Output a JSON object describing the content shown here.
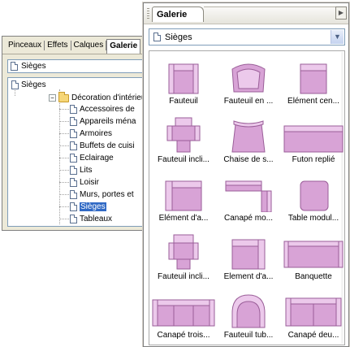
{
  "back_panel": {
    "tabs": [
      "Pinceaux",
      "Effets",
      "Calques",
      "Galerie"
    ],
    "active_tab": 3,
    "dropdown_value": "Sièges",
    "tree": [
      {
        "label": "Sièges",
        "type": "doc",
        "level": 0
      },
      {
        "label": "Décoration d'intérieur",
        "type": "folder",
        "level": 1,
        "expanded": true
      },
      {
        "label": "Accessoires de",
        "type": "doc",
        "level": 2
      },
      {
        "label": "Appareils ména",
        "type": "doc",
        "level": 2
      },
      {
        "label": "Armoires",
        "type": "doc",
        "level": 2
      },
      {
        "label": "Buffets de cuisi",
        "type": "doc",
        "level": 2
      },
      {
        "label": "Eclairage",
        "type": "doc",
        "level": 2
      },
      {
        "label": "Lits",
        "type": "doc",
        "level": 2
      },
      {
        "label": "Loisir",
        "type": "doc",
        "level": 2
      },
      {
        "label": "Murs, portes et",
        "type": "doc",
        "level": 2
      },
      {
        "label": "Sièges",
        "type": "doc",
        "level": 2,
        "selected": true
      },
      {
        "label": "Tableaux",
        "type": "doc",
        "level": 2
      }
    ]
  },
  "gallery": {
    "tab_label": "Galerie",
    "dropdown_value": "Sièges",
    "colors": {
      "fill": "#d8a3d6",
      "stroke": "#9a5e98",
      "light": "#ecc9eb"
    },
    "items": [
      {
        "label": "Fauteuil",
        "shape": "armchair"
      },
      {
        "label": "Fauteuil en ...",
        "shape": "armchair-round"
      },
      {
        "label": "Elément cen...",
        "shape": "center-piece"
      },
      {
        "label": "Fauteuil incli...",
        "shape": "recliner"
      },
      {
        "label": "Chaise de s...",
        "shape": "desk-chair"
      },
      {
        "label": "Futon replié",
        "shape": "futon"
      },
      {
        "label": "Elément d'a...",
        "shape": "corner"
      },
      {
        "label": "Canapé mo...",
        "shape": "l-sofa"
      },
      {
        "label": "Table modul...",
        "shape": "table"
      },
      {
        "label": "Fauteuil incli...",
        "shape": "recliner2"
      },
      {
        "label": "Element d'a...",
        "shape": "corner2"
      },
      {
        "label": "Banquette",
        "shape": "bench"
      },
      {
        "label": "Canapé trois...",
        "shape": "sofa3"
      },
      {
        "label": "Fauteuil tub...",
        "shape": "tub"
      },
      {
        "label": "Canapé deu...",
        "shape": "sofa2"
      }
    ]
  }
}
